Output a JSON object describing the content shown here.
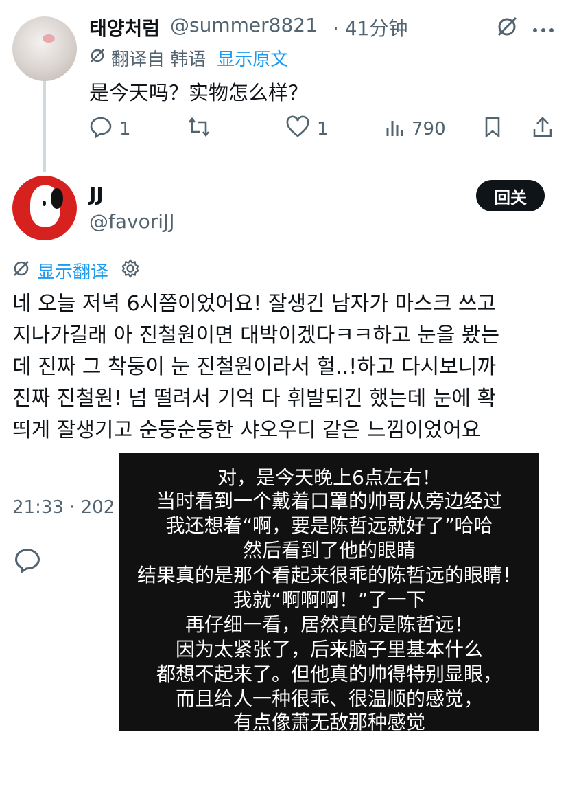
{
  "reply": {
    "display_name": "태양처럼",
    "handle": "@summer8821",
    "time": "· 41分钟",
    "translated_from": "翻译自 韩语",
    "show_original": "显示原文",
    "text": "是今天吗？实物怎么样？",
    "stats": {
      "replies": "1",
      "reposts": "",
      "likes": "1",
      "views": "790"
    }
  },
  "main_tweet": {
    "display_name": "JJ",
    "handle": "@favoriJJ",
    "follow_label": "回关",
    "show_translation": "显示翻译",
    "lines": [
      "네 오늘 저녁 6시쯤이었어요! 잘생긴 남자가 마스크 쓰고",
      "지나가길래 아 진철원이면 대박이겠다ㅋㅋ하고 눈을 봤는",
      "데 진짜 그 착둥이 눈 진철원이라서 헐..!하고 다시보니까",
      "진짜 진철원! 넘 떨려서 기억 다 휘발되긴 했는데 눈에 확",
      "띄게 잘생기고 순둥순둥한 샤오우디 같은 느낌이었어요"
    ],
    "timestamp": "21:33 · 202"
  },
  "subtitle_overlay": [
    "对，是今天晚上6点左右！",
    "当时看到一个戴着口罩的帅哥从旁边经过",
    "我还想着“啊，要是陈哲远就好了”哈哈",
    "然后看到了他的眼睛",
    "结果真的是那个看起来很乖的陈哲远的眼睛！",
    "我就“啊啊啊！”了一下",
    "再仔细一看，居然真的是陈哲远！",
    "因为太紧张了，后来脑子里基本什么",
    "都想不起来了。但他真的帅得特别显眼，",
    "而且给人一种很乖、很温顺的感觉，",
    "有点像萧无敌那种感觉"
  ],
  "colors": {
    "accent": "#1d9bf0",
    "text": "#0f1419",
    "secondary": "#536471",
    "overlay_bg": "#111111"
  }
}
